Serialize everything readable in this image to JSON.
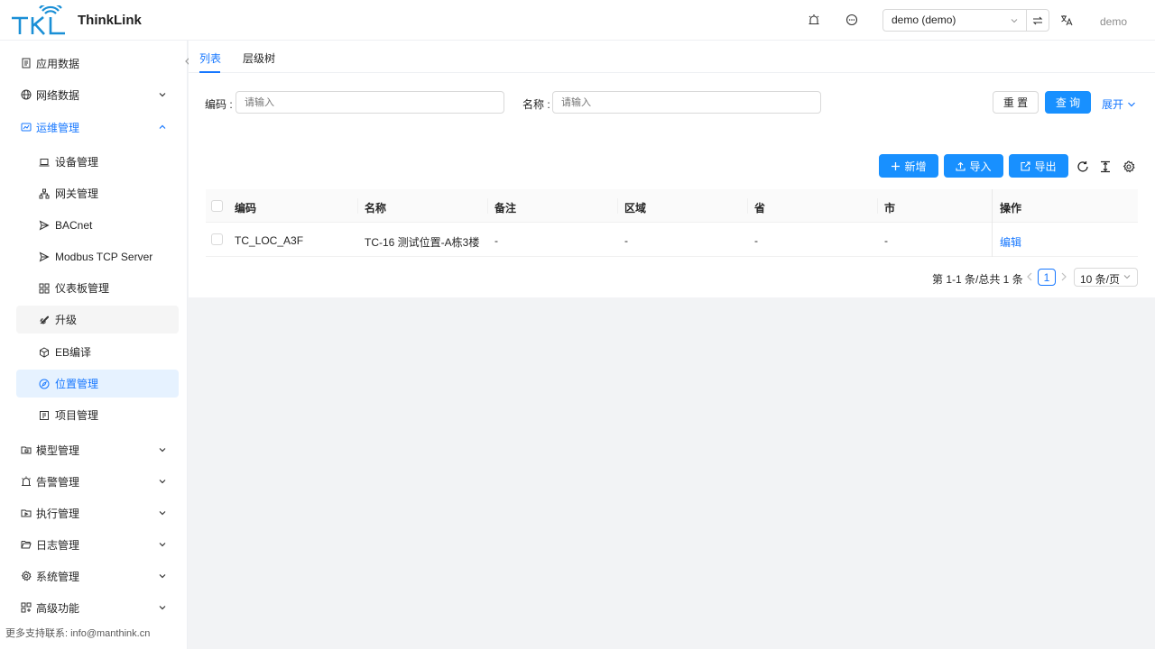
{
  "header": {
    "brand": "ThinkLink",
    "logo_text": "TKL",
    "icons": [
      "alarm-icon",
      "message-icon",
      "switch-icon",
      "translate-icon"
    ],
    "tenant_select_value": "demo (demo)",
    "user_name": "demo"
  },
  "sidebar": {
    "items": [
      {
        "label": "应用数据",
        "icon": "file-icon"
      },
      {
        "label": "网络数据",
        "icon": "globe-icon",
        "expandable": true
      },
      {
        "label": "运维管理",
        "icon": "ops-icon",
        "expanded": true
      },
      {
        "label": "模型管理",
        "icon": "model-icon",
        "expandable": true
      },
      {
        "label": "告警管理",
        "icon": "alarm-icon",
        "expandable": true
      },
      {
        "label": "执行管理",
        "icon": "exec-icon",
        "expandable": true
      },
      {
        "label": "日志管理",
        "icon": "folder-icon",
        "expandable": true
      },
      {
        "label": "系统管理",
        "icon": "gear-icon",
        "expandable": true
      },
      {
        "label": "高级功能",
        "icon": "apps-icon",
        "expandable": true
      }
    ],
    "ops_children": [
      {
        "label": "设备管理",
        "icon": "laptop-icon"
      },
      {
        "label": "网关管理",
        "icon": "network-icon"
      },
      {
        "label": "BACnet",
        "icon": "send-icon"
      },
      {
        "label": "Modbus TCP Server",
        "icon": "send-icon"
      },
      {
        "label": "仪表板管理",
        "icon": "dashboard-icon"
      },
      {
        "label": "升级",
        "icon": "rocket-icon"
      },
      {
        "label": "EB编译",
        "icon": "cube-icon"
      },
      {
        "label": "位置管理",
        "icon": "compass-icon",
        "active": true
      },
      {
        "label": "项目管理",
        "icon": "project-icon"
      }
    ],
    "footer": "更多支持联系: info@manthink.cn"
  },
  "tabs": [
    {
      "label": "列表",
      "active": true
    },
    {
      "label": "层级树"
    }
  ],
  "search": {
    "code_label": "编码 :",
    "code_placeholder": "请输入",
    "name_label": "名称 :",
    "name_placeholder": "请输入",
    "reset_label": "重 置",
    "query_label": "查 询",
    "expand_label": "展开"
  },
  "toolbar": {
    "add_label": "新增",
    "import_label": "导入",
    "export_label": "导出",
    "icons": [
      "reload-icon",
      "column-height-icon",
      "setting-icon"
    ]
  },
  "table": {
    "columns": [
      "编码",
      "名称",
      "备注",
      "区域",
      "省",
      "市",
      "操作"
    ],
    "rows": [
      {
        "code": "TC_LOC_A3F",
        "name": "TC-16 测试位置-A栋3楼",
        "remark": "-",
        "area": "-",
        "province": "-",
        "city": "-",
        "action": "编辑"
      }
    ]
  },
  "pagination": {
    "total_text": "第 1-1 条/总共 1 条",
    "current_page": "1",
    "page_size": "10 条/页"
  },
  "colors": {
    "primary": "#1890ff",
    "link": "#1677ff",
    "active_menu_bg": "#e6f2ff",
    "logo": "#1a8fd6"
  }
}
